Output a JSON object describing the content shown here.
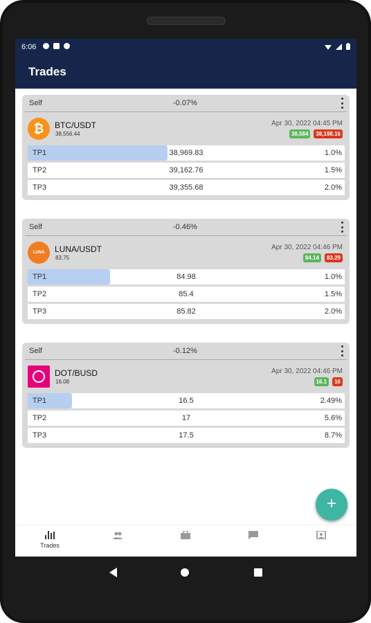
{
  "status_bar": {
    "time": "6:06"
  },
  "app_bar": {
    "title": "Trades"
  },
  "trades": [
    {
      "type": "Self",
      "change": "-0.07%",
      "pair": "BTC/USDT",
      "last_price": "38,556.44",
      "coin_icon": "bitcoin-icon",
      "coin_color": "#f7931a",
      "datetime": "Apr 30, 2022 04:45 PM",
      "entry": "38,584",
      "stop": "38,198.16",
      "targets": [
        {
          "label": "TP1",
          "price": "38,969.83",
          "percent": "1.0%",
          "progress": 0.44
        },
        {
          "label": "TP2",
          "price": "39,162.76",
          "percent": "1.5%",
          "progress": 0
        },
        {
          "label": "TP3",
          "price": "39,355.68",
          "percent": "2.0%",
          "progress": 0
        }
      ]
    },
    {
      "type": "Self",
      "change": "-0.46%",
      "pair": "LUNA/USDT",
      "last_price": "83.75",
      "coin_icon": "luna-icon",
      "coin_label": "LUNA",
      "coin_color": "#ef7d22",
      "datetime": "Apr 30, 2022 04:46 PM",
      "entry": "84.14",
      "stop": "83.29",
      "targets": [
        {
          "label": "TP1",
          "price": "84.98",
          "percent": "1.0%",
          "progress": 0.26
        },
        {
          "label": "TP2",
          "price": "85.4",
          "percent": "1.5%",
          "progress": 0
        },
        {
          "label": "TP3",
          "price": "85.82",
          "percent": "2.0%",
          "progress": 0
        }
      ]
    },
    {
      "type": "Self",
      "change": "-0.12%",
      "pair": "DOT/BUSD",
      "last_price": "16.08",
      "coin_icon": "polkadot-icon",
      "coin_color": "#e6007a",
      "datetime": "Apr 30, 2022 04:46 PM",
      "entry": "16.1",
      "stop": "16",
      "targets": [
        {
          "label": "TP1",
          "price": "16.5",
          "percent": "2.49%",
          "progress": 0.14
        },
        {
          "label": "TP2",
          "price": "17",
          "percent": "5.6%",
          "progress": 0
        },
        {
          "label": "TP3",
          "price": "17.5",
          "percent": "8.7%",
          "progress": 0
        }
      ]
    }
  ],
  "fab": {
    "icon": "plus-icon",
    "symbol": "+"
  },
  "bottom_nav": [
    {
      "label": "Trades",
      "icon": "bar-chart-icon",
      "active": true
    },
    {
      "label": "",
      "icon": "people-icon",
      "active": false
    },
    {
      "label": "",
      "icon": "briefcase-icon",
      "active": false
    },
    {
      "label": "",
      "icon": "chat-icon",
      "active": false
    },
    {
      "label": "",
      "icon": "account-box-icon",
      "active": false
    }
  ],
  "colors": {
    "header": "#15264a",
    "accent": "#3fb5a3",
    "progress": "#b6ceef",
    "badge_green": "#5bb75b",
    "badge_red": "#d9381e"
  }
}
